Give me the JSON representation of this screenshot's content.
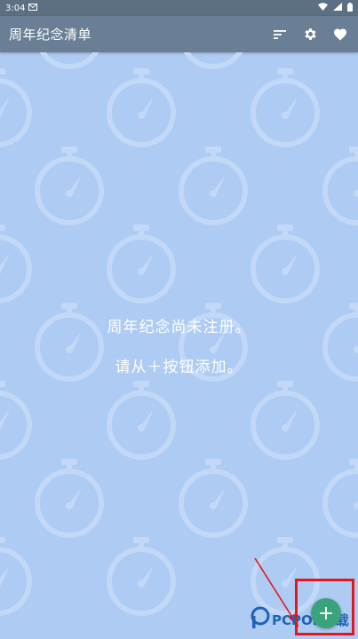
{
  "status_bar": {
    "time": "3:04"
  },
  "app_bar": {
    "title": "周年纪念清单"
  },
  "empty_state": {
    "line1": "周年纪念尚未注册。",
    "line2": "请从＋按钮添加。"
  },
  "fab": {
    "label": "+"
  },
  "watermark": {
    "text": "PCPOP下载"
  },
  "colors": {
    "status_bar": "#5d6f82",
    "app_bar": "#6a7f96",
    "background": "#aecbf3",
    "pattern": "#c3d8f7",
    "fab": "#3aa27d",
    "highlight": "#e3161b"
  },
  "icons": {
    "sort": "sort-icon",
    "settings": "gear-icon",
    "favorite": "heart-icon",
    "background_pattern": "stopwatch-icon"
  }
}
